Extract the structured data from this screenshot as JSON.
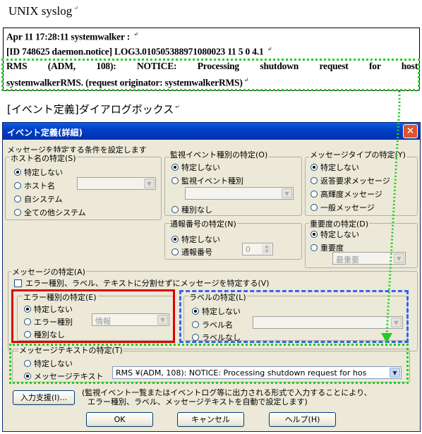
{
  "doc": {
    "title": "UNIX syslog",
    "para_mark": "↵",
    "log_line1": "Apr 11 17:28:11 systemwalker :",
    "log_line2": "[ID 748625 daemon.notice] LOG3.010505388971080023 11 5 0 4.1",
    "log_line3": "RMS (ADM, 108): NOTICE: Processing shutdown request for host",
    "log_line4": "systemwalkerRMS. (request originator: systemwalkerRMS)",
    "dialog_caption": "[イベント定義]ダイアログボックス"
  },
  "dialog": {
    "title": "イベント定義(詳細)",
    "close_glyph": "✕",
    "condition_heading": "メッセージを特定する条件を設定します",
    "host_group": {
      "label": "ホスト名の特定(S)",
      "options": [
        "特定しない",
        "ホスト名",
        "自システム",
        "全ての他システム"
      ],
      "selected": 0
    },
    "event_type_group": {
      "label": "監視イベント種別の特定(O)",
      "options": [
        "特定しない",
        "監視イベント種別",
        "種別なし"
      ],
      "selected": 0
    },
    "message_type_group": {
      "label": "メッセージタイプの特定(Y)",
      "options": [
        "特定しない",
        "返答要求メッセージ",
        "高輝度メッセージ",
        "一般メッセージ"
      ],
      "selected": 0
    },
    "notify_group": {
      "label": "通報番号の特定(N)",
      "options": [
        "特定しない",
        "通報番号"
      ],
      "selected": 0,
      "spin_value": "0"
    },
    "severity_group": {
      "label": "重要度の特定(D)",
      "options": [
        "特定しない",
        "重要度"
      ],
      "selected": 0,
      "combo_value": "最重要"
    },
    "message_group": {
      "label": "メッセージの特定(A)",
      "checkbox_label": "エラー種別、ラベル、テキストに分割せずにメッセージを特定する(V)"
    },
    "error_group": {
      "label": "エラー種別の特定(E)",
      "options": [
        "特定しない",
        "エラー種別",
        "種別なし"
      ],
      "selected": 0,
      "combo_value": "情報"
    },
    "label_group": {
      "label": "ラベルの特定(L)",
      "options": [
        "特定しない",
        "ラベル名",
        "ラベルなし"
      ],
      "selected": 0
    },
    "text_group": {
      "label": "メッセージテキストの特定(T)",
      "options": [
        "特定しない",
        "メッセージテキスト"
      ],
      "selected": 1,
      "text_value": "RMS          ¥(ADM, 108): NOTICE: Processing shutdown request for hos"
    },
    "input_support_button": "入力支援(I)...",
    "input_support_note_1": "(監視イベント一覧またはイベントログ等に出力される形式で入力することにより、",
    "input_support_note_2": "エラー種別、ラベル、メッセージテキストを自動で設定します)",
    "ok_button": "OK",
    "cancel_button": "キャンセル",
    "help_button": "ヘルプ(H)"
  },
  "colors": {
    "highlight_green": "#22cc22",
    "highlight_red": "#e00000",
    "highlight_blue": "#3366ee",
    "titlebar": "#0040c8",
    "dialog_bg": "#ece9d8"
  }
}
